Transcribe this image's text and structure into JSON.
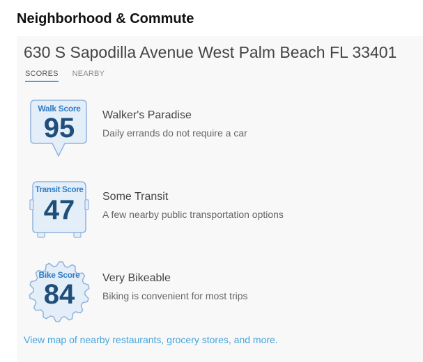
{
  "section": {
    "title": "Neighborhood & Commute"
  },
  "address": "630 S Sapodilla Avenue West Palm Beach FL 33401",
  "tabs": [
    {
      "label": "SCORES",
      "active": true
    },
    {
      "label": "NEARBY",
      "active": false
    }
  ],
  "scores": {
    "walk": {
      "label": "Walk Score",
      "value": "95",
      "title": "Walker's Paradise",
      "description": "Daily errands do not require a car",
      "icon": "walk-score-pin-icon"
    },
    "transit": {
      "label": "Transit Score",
      "value": "47",
      "title": "Some Transit",
      "description": "A few nearby public transportation options",
      "icon": "transit-score-bus-icon"
    },
    "bike": {
      "label": "Bike Score",
      "value": "84",
      "title": "Very Bikeable",
      "description": "Biking is convenient for most trips",
      "icon": "bike-score-gear-icon"
    }
  },
  "map_link": "View map of nearby restaurants, grocery stores, and more.",
  "colors": {
    "badge_fill": "#e4eef9",
    "badge_stroke": "#8fb3dc",
    "badge_label": "#2f7cc4",
    "badge_value": "#1f4e79",
    "link": "#47a3dc",
    "tab_underline": "#47a3dc"
  }
}
